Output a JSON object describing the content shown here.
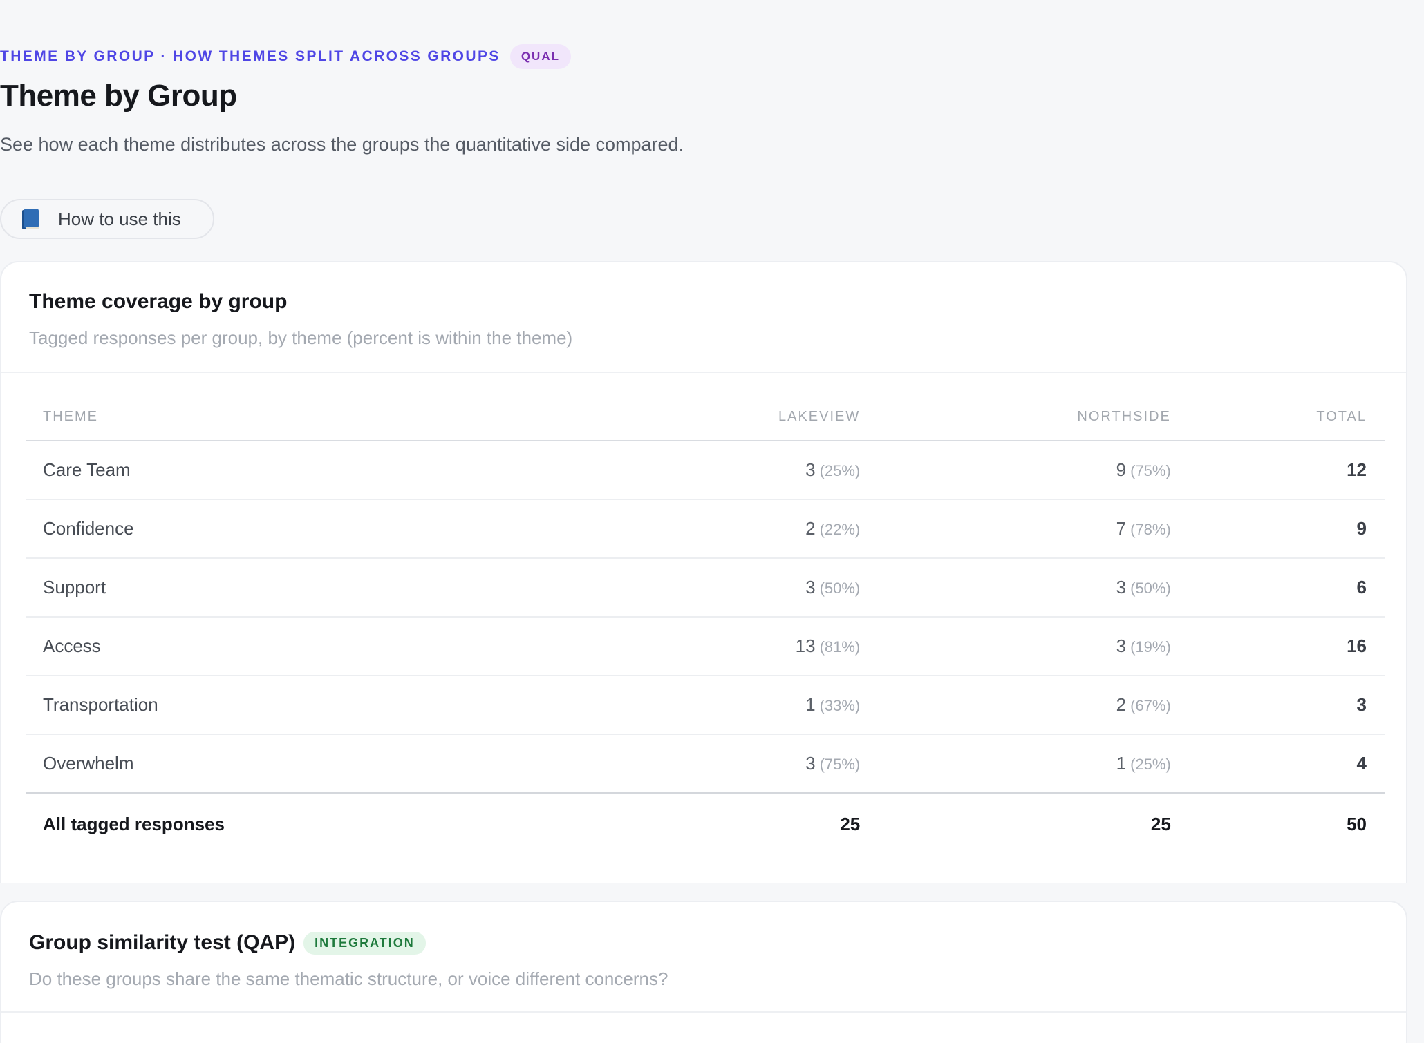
{
  "header": {
    "eyebrow": "THEME BY GROUP · HOW THEMES SPLIT ACROSS GROUPS",
    "badge": "QUAL",
    "title": "Theme by Group",
    "subtitle": "See how each theme distributes across the groups the quantitative side compared.",
    "howto_label": "How to use this",
    "howto_icon": "book-icon"
  },
  "coverage": {
    "title": "Theme coverage by group",
    "description": "Tagged responses per group, by theme (percent is within the theme)",
    "columns": [
      "THEME",
      "LAKEVIEW",
      "NORTHSIDE",
      "TOTAL"
    ],
    "rows": [
      {
        "theme": "Care Team",
        "lakeview": "3",
        "lakeview_pct": "(25%)",
        "northside": "9",
        "northside_pct": "(75%)",
        "total": "12"
      },
      {
        "theme": "Confidence",
        "lakeview": "2",
        "lakeview_pct": "(22%)",
        "northside": "7",
        "northside_pct": "(78%)",
        "total": "9"
      },
      {
        "theme": "Support",
        "lakeview": "3",
        "lakeview_pct": "(50%)",
        "northside": "3",
        "northside_pct": "(50%)",
        "total": "6"
      },
      {
        "theme": "Access",
        "lakeview": "13",
        "lakeview_pct": "(81%)",
        "northside": "3",
        "northside_pct": "(19%)",
        "total": "16"
      },
      {
        "theme": "Transportation",
        "lakeview": "1",
        "lakeview_pct": "(33%)",
        "northside": "2",
        "northside_pct": "(67%)",
        "total": "3"
      },
      {
        "theme": "Overwhelm",
        "lakeview": "3",
        "lakeview_pct": "(75%)",
        "northside": "1",
        "northside_pct": "(25%)",
        "total": "4"
      }
    ],
    "totals": {
      "label": "All tagged responses",
      "lakeview": "25",
      "northside": "25",
      "total": "50"
    }
  },
  "similarity": {
    "title": "Group similarity test (QAP)",
    "badge": "INTEGRATION",
    "description": "Do these groups share the same thematic structure, or voice different concerns?"
  },
  "colors": {
    "accent": "#4f46e5",
    "qual_badge": "#7b2fb0",
    "integration_badge": "#1e7a3c"
  }
}
